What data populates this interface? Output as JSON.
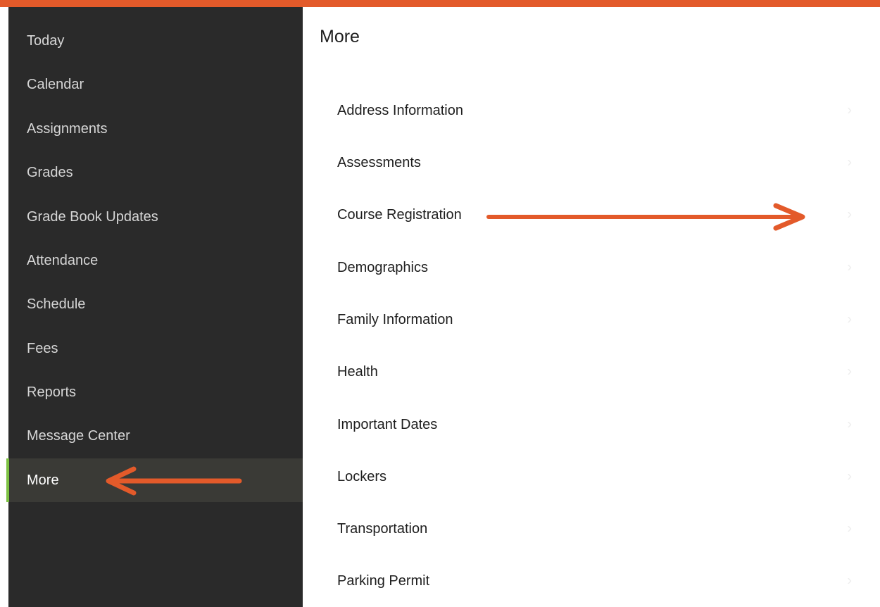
{
  "sidebar": {
    "items": [
      {
        "label": "Today"
      },
      {
        "label": "Calendar"
      },
      {
        "label": "Assignments"
      },
      {
        "label": "Grades"
      },
      {
        "label": "Grade Book Updates"
      },
      {
        "label": "Attendance"
      },
      {
        "label": "Schedule"
      },
      {
        "label": "Fees"
      },
      {
        "label": "Reports"
      },
      {
        "label": "Message Center"
      },
      {
        "label": "More",
        "active": true
      }
    ]
  },
  "main": {
    "title": "More",
    "items": [
      {
        "label": "Address Information"
      },
      {
        "label": "Assessments"
      },
      {
        "label": "Course Registration"
      },
      {
        "label": "Demographics"
      },
      {
        "label": "Family Information"
      },
      {
        "label": "Health"
      },
      {
        "label": "Important Dates"
      },
      {
        "label": "Lockers"
      },
      {
        "label": "Transportation"
      },
      {
        "label": "Parking Permit"
      }
    ],
    "chevron": "›"
  },
  "colors": {
    "accent_orange": "#e35a2a",
    "active_green": "#7cc142",
    "sidebar_bg": "#2a2a2a"
  }
}
